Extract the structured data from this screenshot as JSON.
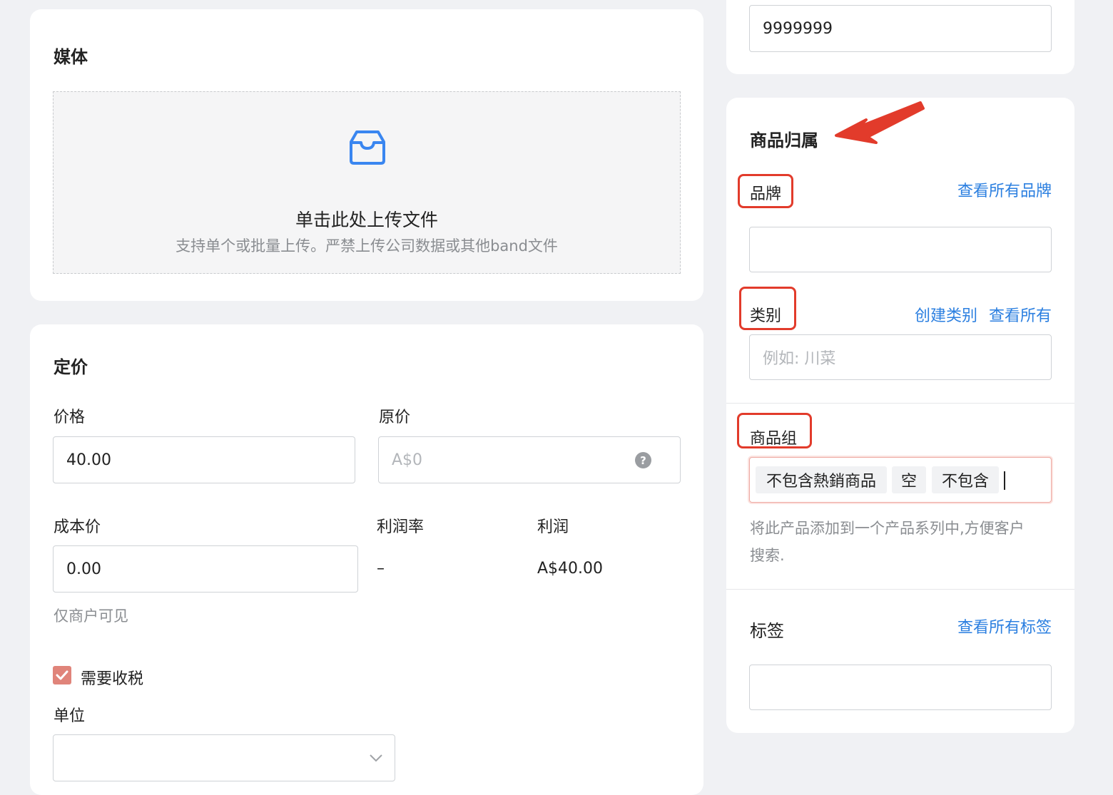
{
  "top_input": {
    "value": "9999999"
  },
  "media": {
    "title": "媒体",
    "upload_title": "单击此处上传文件",
    "upload_hint": "支持单个或批量上传。严禁上传公司数据或其他band文件",
    "icon": "inbox-icon",
    "accent": "#3a86f0"
  },
  "pricing": {
    "title": "定价",
    "price_label": "价格",
    "price_value": "40.00",
    "original_label": "原价",
    "original_placeholder": "A$0",
    "help_icon": "question-icon",
    "cost_label": "成本价",
    "cost_value": "0.00",
    "margin_label": "利润率",
    "margin_value": "–",
    "profit_label": "利润",
    "profit_value": "A$40.00",
    "cost_hint": "仅商户可见",
    "tax_label": "需要收税",
    "tax_checked": true,
    "unit_label": "单位",
    "unit_value": ""
  },
  "attribution": {
    "title": "商品归属",
    "brand_label": "品牌",
    "brand_link": "查看所有品牌",
    "brand_value": "",
    "category_label": "类别",
    "category_create_link": "创建类别",
    "category_view_link": "查看所有",
    "category_placeholder": "例如: 川菜",
    "group_label": "商品组",
    "group_tags": [
      "不包含熱銷商品",
      "空",
      "不包含"
    ],
    "group_hint_line1": "将此产品添加到一个产品系列中,方便客户",
    "group_hint_line2": "搜索.",
    "tags_label": "标签",
    "tags_link": "查看所有标签",
    "tags_value": ""
  },
  "colors": {
    "link": "#2b7fe0",
    "annotation_red": "#e23b2b",
    "checkbox": "#e0847a"
  }
}
